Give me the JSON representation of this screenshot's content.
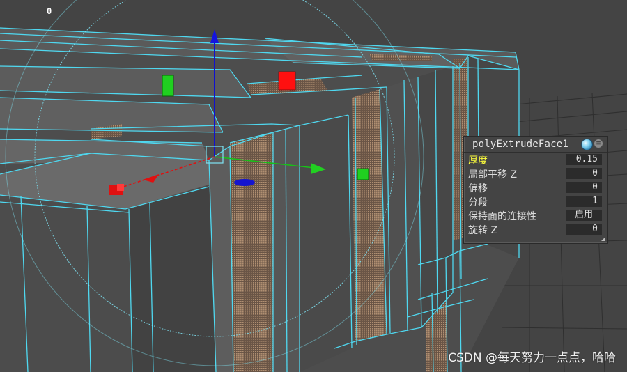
{
  "viewport": {
    "frame_counter": "0",
    "watermark": "CSDN @每天努力一点点，哈哈"
  },
  "colors": {
    "background": "#444444",
    "mesh_face": "#595959",
    "mesh_face_dark": "#4b4b4b",
    "wireframe": "#4fd8f0",
    "selected_face": "#8a6f58",
    "manip_x": "#e01010",
    "manip_y": "#1010d0",
    "manip_z": "#18c018",
    "highlight_label": "#ffff3c"
  },
  "manipulator": {
    "handles": [
      "x-axis",
      "y-axis",
      "z-axis",
      "rotation-ring"
    ]
  },
  "channel_box": {
    "node_name": "polyExtrudeFace1",
    "icons": [
      "node-sphere-icon",
      "options-menu-icon"
    ],
    "attributes": [
      {
        "label": "厚度",
        "value": "0.15",
        "active": true
      },
      {
        "label": "局部平移 Z",
        "value": "0",
        "active": false
      },
      {
        "label": "偏移",
        "value": "0",
        "active": false
      },
      {
        "label": "分段",
        "value": "1",
        "active": false
      },
      {
        "label": "保持面的连接性",
        "value": "启用",
        "active": false
      },
      {
        "label": "旋转 Z",
        "value": "0",
        "active": false
      }
    ]
  }
}
